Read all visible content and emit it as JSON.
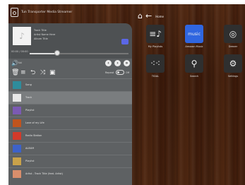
{
  "app": {
    "title": "Tun Transporter Media Streamer"
  },
  "now_playing": {
    "lines": [
      "Track Title",
      "Artist Name Here",
      "Album Title"
    ],
    "time": "00:00 / 00:00"
  },
  "seek": {
    "fraction": 0.28
  },
  "volume": {
    "label": "Vol"
  },
  "repeat": {
    "label": "Repeat",
    "state": "Off"
  },
  "playlist": {
    "items": [
      {
        "title": "Song",
        "thumb_color": "#2e8c9c"
      },
      {
        "title": "Track",
        "thumb_color": "#e8e8e8"
      },
      {
        "title": "Playlist",
        "thumb_color": "#7b5ab3"
      },
      {
        "title": "Love of my Life",
        "thumb_color": "#c0541e"
      },
      {
        "title": "Radio Station",
        "thumb_color": "#d23a2a"
      },
      {
        "title": "ALBUM",
        "thumb_color": "#3d62c9"
      },
      {
        "title": "Playlist",
        "thumb_color": "#c9a24a"
      },
      {
        "title": "Artist - Track Title (feat. Artist)",
        "thumb_color": "#d98e6c"
      }
    ],
    "active_index": 1
  },
  "nav": {
    "breadcrumb": "Home"
  },
  "tiles": [
    {
      "label": "My Playlists",
      "icon": "playlist-icon",
      "glyph": "≡♪"
    },
    {
      "label": "Amazon Music",
      "icon": "amazon-music-icon",
      "glyph": "music",
      "color": "#2f66e0"
    },
    {
      "label": "Deezer",
      "icon": "disc-icon",
      "glyph": "◎"
    },
    {
      "label": "TIDAL",
      "icon": "tidal-icon",
      "glyph": "⁖⁖"
    },
    {
      "label": "Search",
      "icon": "search-icon",
      "glyph": "⚲"
    },
    {
      "label": "Settings",
      "icon": "gear-icon",
      "glyph": "⚙"
    }
  ]
}
